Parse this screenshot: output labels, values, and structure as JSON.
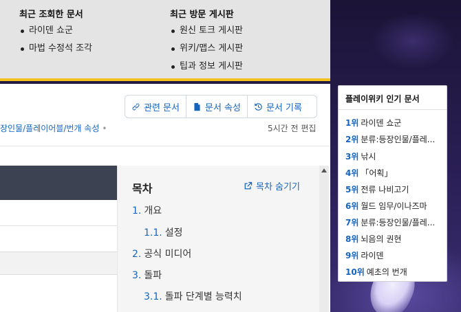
{
  "recent": {
    "viewed_title": "최근 조회한 문서",
    "viewed": [
      "라이덴 쇼군",
      "마법 수정석 조각"
    ],
    "boards_title": "최근 방문 게시판",
    "boards": [
      "원신 토크 게시판",
      "위키/맵스 게시판",
      "팁과 정보 게시판"
    ]
  },
  "toolbar": {
    "related": "관련 문서",
    "properties": "문서 속성",
    "history": "문서 기록"
  },
  "doc": {
    "category": "장인물/플레이어블/번개 속성",
    "category_dot": "•",
    "edit_time": "5시간 전 편집"
  },
  "toc": {
    "title": "목차",
    "hide": "목차 숨기기",
    "items": [
      {
        "num": "1.",
        "label": "개요"
      },
      {
        "num": "1.1.",
        "label": "설정"
      },
      {
        "num": "2.",
        "label": "공식 미디어"
      },
      {
        "num": "3.",
        "label": "돌파"
      },
      {
        "num": "3.1.",
        "label": "돌파 단계별 능력치"
      }
    ]
  },
  "popular": {
    "title": "플레이위키 인기 문서",
    "items": [
      {
        "rank": "1위",
        "label": "라이덴 쇼군"
      },
      {
        "rank": "2위",
        "label": "분류:등장인물/플레..."
      },
      {
        "rank": "3위",
        "label": "낚시"
      },
      {
        "rank": "4위",
        "label": "「어획」"
      },
      {
        "rank": "5위",
        "label": "전류 나비고기"
      },
      {
        "rank": "6위",
        "label": "월드 임무/이나즈마"
      },
      {
        "rank": "7위",
        "label": "분류:등장인물/플레..."
      },
      {
        "rank": "8위",
        "label": "뇌음의 권현"
      },
      {
        "rank": "9위",
        "label": "라이덴"
      },
      {
        "rank": "10위",
        "label": "예초의 번개"
      }
    ]
  },
  "colors": {
    "accent": "#1565c0",
    "highlight_bar": "#f2c01e",
    "dark_band": "#3c4251"
  }
}
